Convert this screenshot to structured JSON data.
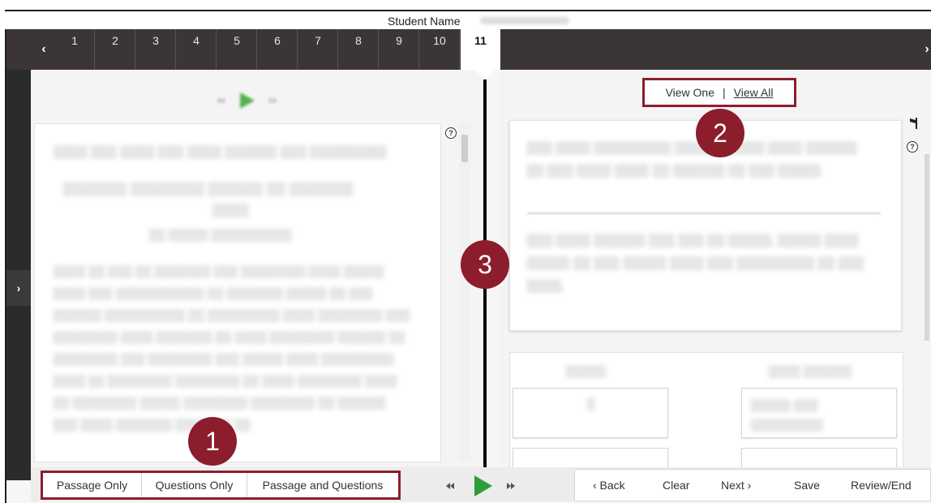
{
  "header": {
    "student_label": "Student Name"
  },
  "tabs": [
    "1",
    "2",
    "3",
    "4",
    "5",
    "6",
    "7",
    "8",
    "9",
    "10",
    "11"
  ],
  "active_tab": "11",
  "icons": {
    "prev": "chevron-left-icon",
    "next": "chevron-right-icon",
    "help": "question-circle-icon",
    "flag": "flag-icon",
    "play": "play-icon",
    "rewind": "rewind-icon",
    "fast_forward": "fast-forward-icon"
  },
  "view_toggle": {
    "one": "View One",
    "separator": "|",
    "all": "View All"
  },
  "mode_buttons": [
    "Passage Only",
    "Questions Only",
    "Passage and Questions"
  ],
  "nav_buttons": {
    "back": "‹ Back",
    "clear": "Clear",
    "next": "Next ›",
    "save": "Save",
    "review": "Review/End"
  },
  "badges": [
    "1",
    "2",
    "3"
  ],
  "colors": {
    "accent": "#8c1d2d",
    "play_green": "#2e9e3a",
    "tab_bar": "#3b3535"
  }
}
